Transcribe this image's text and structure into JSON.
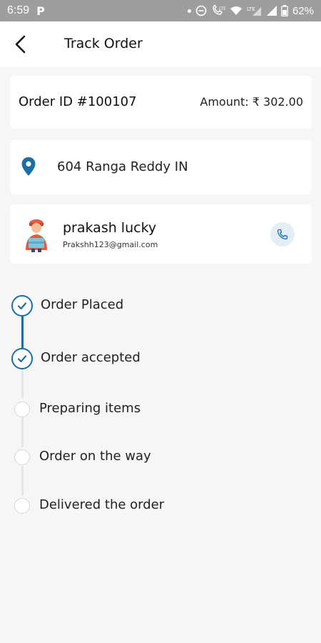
{
  "status_bar": {
    "time": "6:59",
    "app_icon": "P",
    "battery": "62%",
    "icons": [
      "dot-icon",
      "do-not-disturb-icon",
      "volte-icon",
      "wifi-icon",
      "lte-icon",
      "signal-icon",
      "signal-icon",
      "battery-icon"
    ]
  },
  "header": {
    "title": "Track Order",
    "back_icon": "back-arrow-icon"
  },
  "order": {
    "id_label": "Order ID #100107",
    "amount_label": "Amount: ₹ 302.00"
  },
  "address": {
    "icon": "location-pin-icon",
    "text": "604 Ranga Reddy IN"
  },
  "customer": {
    "name": "prakash lucky",
    "email": "Prakshh123@gmail.com",
    "avatar_icon": "delivery-person-avatar",
    "call_icon": "phone-icon"
  },
  "timeline": {
    "steps": [
      {
        "label": "Order Placed",
        "done": true
      },
      {
        "label": "Order accepted",
        "done": true
      },
      {
        "label": "Preparing items",
        "done": false
      },
      {
        "label": "Order on the way",
        "done": false
      },
      {
        "label": "Delivered the order",
        "done": false
      }
    ]
  },
  "colors": {
    "accent": "#1b6ea8",
    "pin": "#1a6fa6",
    "status_bar": "#9e9e9e",
    "background": "#f6f6f6"
  }
}
